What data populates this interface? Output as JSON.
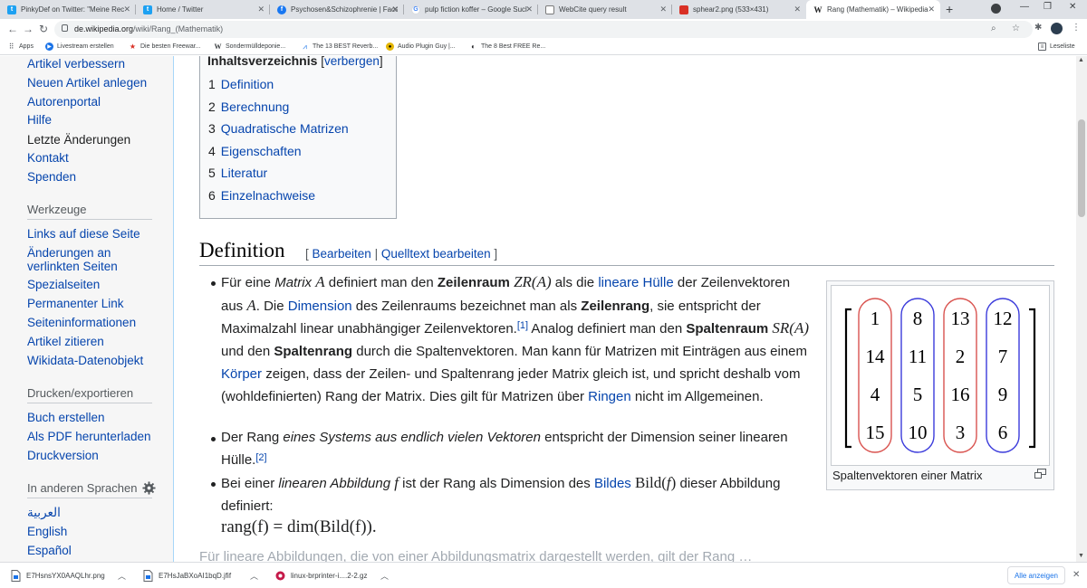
{
  "browser": {
    "tabs": [
      {
        "title": "PinkyDef on Twitter: \"Meine Rec",
        "icon": "twitter-icon",
        "color": "#1da1f2"
      },
      {
        "title": "Home / Twitter",
        "icon": "twitter-icon",
        "color": "#1da1f2"
      },
      {
        "title": "Psychosen&Schizophrenie | Face",
        "icon": "facebook-icon",
        "color": "#1877f2"
      },
      {
        "title": "pulp fiction koffer – Google Sucl",
        "icon": "google-icon",
        "color": "#4285f4"
      },
      {
        "title": "WebCite query result",
        "icon": "webcite-icon",
        "color": "#7a7a7a"
      },
      {
        "title": "sphear2.png (533×431)",
        "icon": "image-icon",
        "color": "#d93025"
      },
      {
        "title": "Rang (Mathematik) – Wikipedia",
        "icon": "wikipedia-icon",
        "color": "#202122"
      }
    ],
    "url_host": "de.wikipedia.org",
    "url_path": "/wiki/Rang_(Mathematik)",
    "bookmarks": [
      {
        "label": "Apps",
        "icon": "apps-icon"
      },
      {
        "label": "Livestream erstellen",
        "icon": "livestream-icon"
      },
      {
        "label": "Die besten Freewar...",
        "icon": "star-icon"
      },
      {
        "label": "Sondermülldeponie...",
        "icon": "w-icon"
      },
      {
        "label": "The 13 BEST Reverb...",
        "icon": "reverb-icon"
      },
      {
        "label": "Audio Plugin Guy |...",
        "icon": "plugin-icon"
      },
      {
        "label": "The 8 Best FREE Re...",
        "icon": "moon-icon"
      }
    ],
    "reading_list": "Leseliste"
  },
  "sidebar": {
    "links_top": [
      "Artikel verbessern",
      "Neuen Artikel anlegen",
      "Autorenportal",
      "Hilfe",
      "Letzte Änderungen",
      "Kontakt",
      "Spenden"
    ],
    "tools_heading": "Werkzeuge",
    "tools": [
      "Links auf diese Seite",
      "Änderungen an",
      "verlinkten Seiten",
      "Spezialseiten",
      "Permanenter Link",
      "Seiteninformationen",
      "Artikel zitieren",
      "Wikidata-Datenobjekt"
    ],
    "print_heading": "Drucken/exportieren",
    "print": [
      "Buch erstellen",
      "Als PDF herunterladen",
      "Druckversion"
    ],
    "lang_heading": "In anderen Sprachen",
    "languages": [
      "العربية",
      "English",
      "Español"
    ]
  },
  "toc": {
    "title": "Inhaltsverzeichnis",
    "toggle_open": "[",
    "toggle_label": "verbergen",
    "toggle_close": "]",
    "items": [
      {
        "num": "1",
        "label": "Definition"
      },
      {
        "num": "2",
        "label": "Berechnung"
      },
      {
        "num": "3",
        "label": "Quadratische Matrizen"
      },
      {
        "num": "4",
        "label": "Eigenschaften"
      },
      {
        "num": "5",
        "label": "Literatur"
      },
      {
        "num": "6",
        "label": "Einzelnachweise"
      }
    ]
  },
  "section": {
    "heading": "Definition",
    "edit_open": "[ ",
    "edit_label": "Bearbeiten",
    "edit_sep": " | ",
    "source_label": "Quelltext bearbeiten",
    "edit_close": " ]"
  },
  "paragraphs": {
    "p1": [
      "Für eine ",
      "Matrix",
      " ",
      "A",
      " definiert man den ",
      "Zeilenraum",
      " ",
      "ZR(A)",
      " als die ",
      "lineare Hülle",
      " der Zeilenvektoren aus ",
      "A",
      ". Die ",
      "Dimension",
      " des Zeilenraums bezeichnet man als ",
      "Zeilenrang",
      ", sie entspricht der Maximalzahl linear unabhängiger Zeilenvektoren.",
      "[1]",
      " Analog definiert man den ",
      "Spaltenraum",
      " ",
      "SR(A)",
      " und den ",
      "Spaltenrang",
      " durch die Spaltenvektoren. Man kann für Matrizen mit Einträgen aus einem ",
      "Körper",
      " zeigen, dass der Zeilen- und Spaltenrang jeder Matrix gleich ist, und spricht deshalb vom (wohldefinierten) Rang der Matrix. Dies gilt für Matrizen über ",
      "Ringen",
      " nicht im Allgemeinen."
    ],
    "p2": [
      "Der Rang ",
      "eines Systems aus endlich vielen Vektoren",
      " entspricht der Dimension seiner linearen Hülle.",
      "[2]"
    ],
    "p3": [
      "Bei einer ",
      "linearen Abbildung",
      " ",
      "f",
      " ist der Rang als Dimension des ",
      "Bildes",
      " ",
      "Bild(",
      "f",
      ")",
      " dieser Abbildung definiert:"
    ],
    "formula": "rang(f) = dim(Bild(f)).",
    "faded": "Für lineare Abbildungen, die von einer Abbildungsmatrix dargestellt werden, gilt der Rang …"
  },
  "thumb": {
    "caption": "Spaltenvektoren einer Matrix",
    "matrix": [
      [
        1,
        8,
        13,
        12
      ],
      [
        14,
        11,
        2,
        7
      ],
      [
        4,
        5,
        16,
        9
      ],
      [
        15,
        10,
        3,
        6
      ]
    ],
    "column_colors": [
      "#d9534f",
      "#3b3bdb",
      "#d9534f",
      "#3b3bdb"
    ]
  },
  "downloads": [
    {
      "name": "E7HsnsYX0AAQLhr.png"
    },
    {
      "name": "E7HsJaBXoAI1bqD.jfif"
    },
    {
      "name": "linux-brprinter-i....2-2.gz"
    }
  ],
  "show_all": "Alle anzeigen"
}
